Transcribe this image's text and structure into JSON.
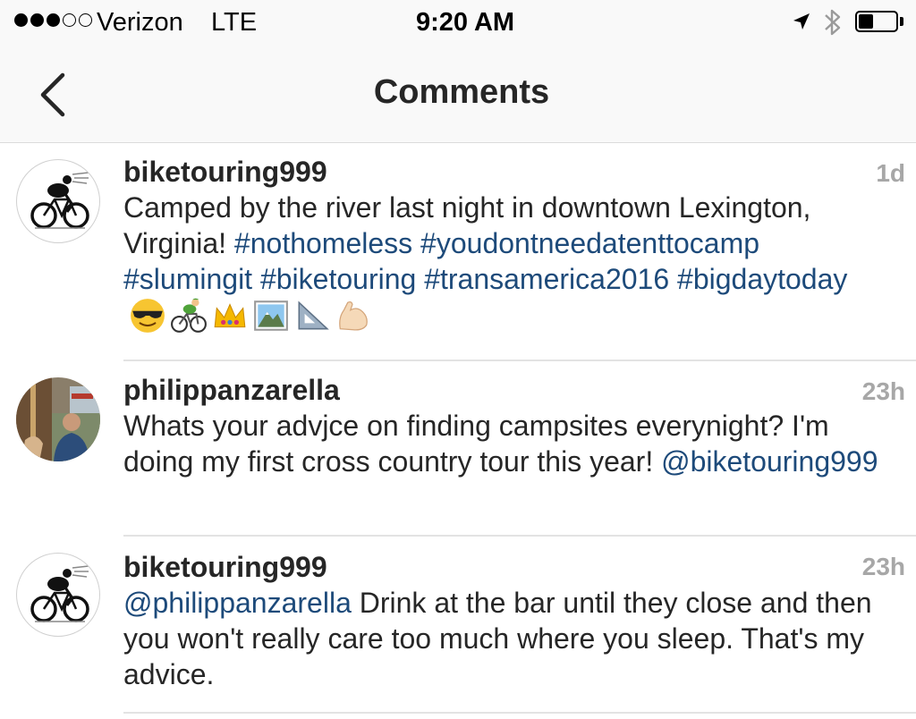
{
  "status_bar": {
    "carrier": "Verizon",
    "network": "LTE",
    "time": "9:20 AM",
    "signal_bars_filled": 3,
    "signal_bars_total": 5,
    "battery_level": 0.4
  },
  "nav": {
    "title": "Comments",
    "back_icon": "chevron-left-icon"
  },
  "comments": [
    {
      "username": "biketouring999",
      "time": "1d",
      "text": "Camped by the river last night in downtown Lexington, Virginia!",
      "hashtags": [
        "#nothomeless",
        "#youdontneedatenttocamp",
        "#slumingit",
        "#biketouring",
        "#transamerica2016",
        "#bigdaytoday"
      ],
      "emojis": [
        "sunglasses-face-emoji",
        "bicyclist-emoji",
        "crown-emoji",
        "mountain-picture-emoji",
        "triangular-ruler-emoji",
        "flexed-biceps-emoji"
      ]
    },
    {
      "username": "philippanzarella",
      "time": "23h",
      "text": "Whats your advjce on finding campsites everynight? I'm doing my first cross country tour this year!",
      "mention": "@biketouring999"
    },
    {
      "username": "biketouring999",
      "time": "23h",
      "mention": "@philippanzarella",
      "text": "Drink at the bar until they close and then you won't really care too much where you sleep. That's my advice."
    }
  ]
}
